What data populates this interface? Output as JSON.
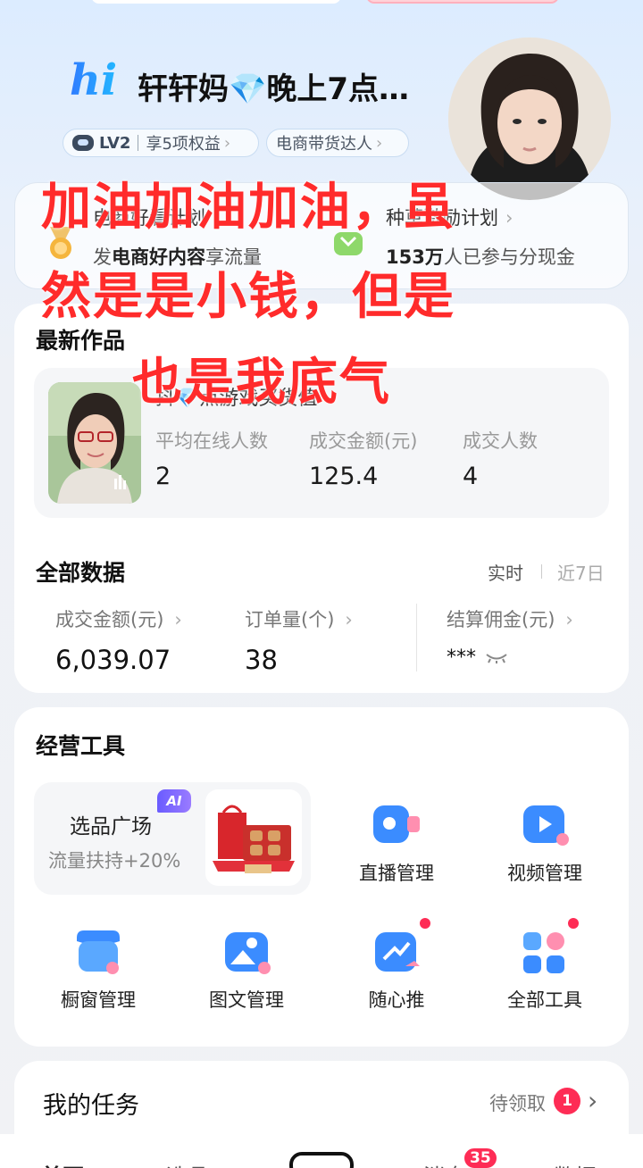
{
  "header": {
    "logo_text": "hi",
    "user_name": "轩轩妈💎晚上7点…",
    "level": "LV2",
    "benefits": "享5项权益",
    "role_badge": "电商带货达人"
  },
  "banner": {
    "left_title": "电商好看计划",
    "left_sub_prefix": "发",
    "left_sub_bold": "电商好内容",
    "left_sub_suffix": "享流量",
    "right_title": "种草激励计划",
    "right_sub_bold": "153万",
    "right_sub_suffix": "人已参与分现金"
  },
  "latest_works": {
    "title": "最新作品",
    "live_title": "抖💎点游戏买货值",
    "stats": [
      {
        "label": "平均在线人数",
        "value": "2"
      },
      {
        "label": "成交金额(元)",
        "value": "125.4"
      },
      {
        "label": "成交人数",
        "value": "4"
      }
    ]
  },
  "all_data": {
    "title": "全部数据",
    "toggle_realtime": "实时",
    "toggle_7days": "近7日",
    "metrics": [
      {
        "label": "成交金额(元)",
        "value": "6,039.07"
      },
      {
        "label": "订单量(个)",
        "value": "38"
      },
      {
        "label": "结算佣金(元)",
        "value": "***"
      }
    ]
  },
  "tools": {
    "title": "经营工具",
    "feature_title": "选品广场",
    "feature_sub": "流量扶持+20%",
    "ai_badge": "AI",
    "items": [
      {
        "label": "直播管理",
        "icon": "live-camera-icon"
      },
      {
        "label": "视频管理",
        "icon": "video-play-icon"
      },
      {
        "label": "橱窗管理",
        "icon": "shop-window-icon"
      },
      {
        "label": "图文管理",
        "icon": "image-text-icon"
      },
      {
        "label": "随心推",
        "icon": "promote-icon"
      },
      {
        "label": "全部工具",
        "icon": "all-tools-icon"
      }
    ]
  },
  "tasks": {
    "title": "我的任务",
    "pending_label": "待领取",
    "pending_count": "1"
  },
  "overlay": {
    "line1": "加油加油加油，虽",
    "line2": "然是是小钱，但是",
    "line3": "也是我底气"
  },
  "tabbar": {
    "tab1": "首页",
    "tab2": "选品",
    "tab4": "消息",
    "tab5": "数据",
    "message_badge": "35"
  },
  "colors": {
    "accent_red": "#fe2c55",
    "overlay_red": "#ff2b2b",
    "brand_blue": "#2f7bff"
  }
}
